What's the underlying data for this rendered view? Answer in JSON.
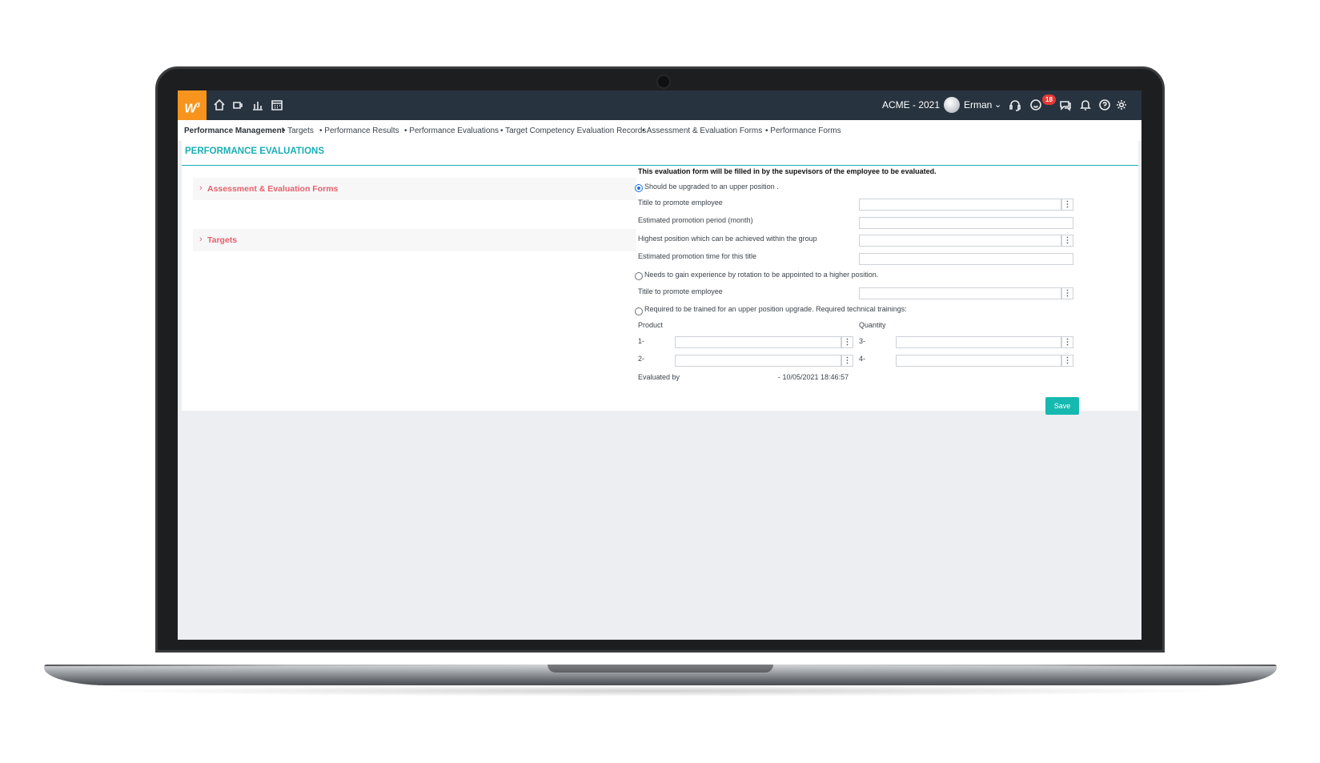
{
  "topbar": {
    "logo_text": "W",
    "logo_sup": "3",
    "company": "ACME - 2021",
    "user": "Erman",
    "notification_count": "18",
    "icons": [
      "home-icon",
      "cup-icon",
      "chart-icon",
      "calendar-icon",
      "headset-icon",
      "smiley-icon",
      "chat-icon",
      "bell-icon",
      "help-icon",
      "gear-icon"
    ]
  },
  "breadcrumb": {
    "root": "Performance Management",
    "items": [
      "• Targets",
      "• Performance Results",
      "• Performance Evaluations",
      "• Target Competency Evaluation Records",
      "• Assessment & Evaluation Forms",
      "• Performance Forms"
    ]
  },
  "page": {
    "title": "PERFORMANCE EVALUATIONS"
  },
  "accordions": [
    {
      "label": "Assessment & Evaluation Forms"
    },
    {
      "label": "Targets"
    }
  ],
  "form": {
    "note": "This evaluation form will be filled in by the supevisors of the employee to be evaluated.",
    "option1": "Should be upgraded to an upper position .",
    "title_promote": "Titile to promote employee",
    "est_period": "Estimated promotion period (month)",
    "highest_position": "Highest position which can be achieved within the group",
    "est_time": "Estimated promotion time for this title",
    "option2": "Needs to gain experience by rotation to be appointed to a higher position.",
    "title_promote2": "Titile to promote employee",
    "option3": "Required to be trained for an upper position upgrade. Required technical trainings:",
    "product_label": "Product",
    "quantity_label": "Quantity",
    "row1": "1-",
    "row2": "2-",
    "row3": "3-",
    "row4": "4-",
    "evaluated_by_label": "Evaluated by",
    "evaluated_by_value": "- 10/05/2021 18:46:57",
    "save_label": "Save"
  },
  "colors": {
    "accent": "#1aaeb5",
    "topbar": "#27333f",
    "logo": "#f7941d",
    "accordion_text": "#e5606c",
    "save_button": "#16b9b0"
  }
}
